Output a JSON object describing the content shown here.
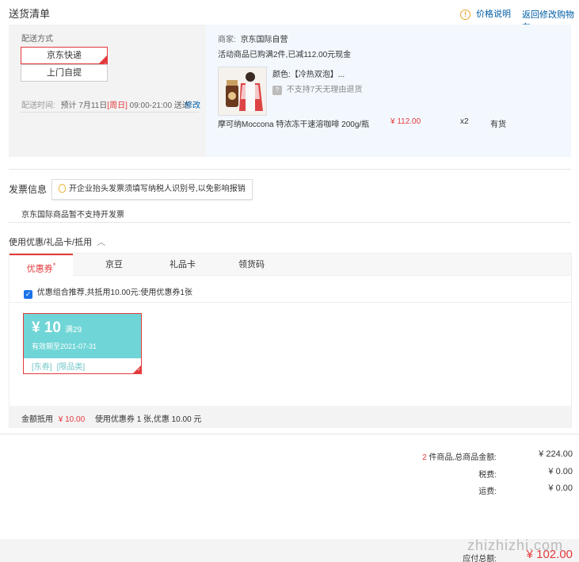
{
  "header": {
    "title": "送货清单",
    "price_info": "价格说明",
    "back_link": "返回修改购物车"
  },
  "shipping": {
    "method_label": "配送方式",
    "options": [
      "京东快递",
      "上门自提"
    ],
    "time_label": "配送时间:",
    "time_prefix": "预计 7月11日",
    "time_day": "[周日]",
    "time_range": "09:00-21:00 送达",
    "modify": "修改"
  },
  "seller": {
    "label": "商家:",
    "name": "京东国际自营",
    "promo": "活动商品已购满2件,已减112.00元现金",
    "color": "颜色:【冷热双泡】...",
    "return_policy": "不支持7天无理由退货",
    "product_name": "摩可纳Moccona 特浓冻干速溶咖啡 200g/瓶",
    "price": "¥ 112.00",
    "qty": "x2",
    "stock": "有货"
  },
  "invoice": {
    "title": "发票信息",
    "tip": "开企业抬头发票须填写纳税人识别号,以免影响报销",
    "note": "京东国际商品暂不支持开发票"
  },
  "discount": {
    "title": "使用优惠/礼品卡/抵用",
    "tabs": [
      "优惠券",
      "京豆",
      "礼品卡",
      "领货码"
    ],
    "tab_mark": "*",
    "recommend": "优惠组合推荐,共抵用10.00元:使用优惠券1张",
    "coupon": {
      "amount": "¥ 10",
      "condition": "满29",
      "validity": "有效期至2021-07-31",
      "tags": [
        "[东券]",
        "[限品类]"
      ]
    },
    "total_label": "金额抵用",
    "total_value": "¥ 10.00",
    "total_desc": "使用优惠券 1 张,优惠 10.00 元"
  },
  "summary": {
    "count": "2",
    "count_suffix": "件商品,总商品金额:",
    "goods_total": "¥ 224.00",
    "tax_label": "税费:",
    "tax": "¥ 0.00",
    "freight_label": "运费:",
    "freight": "¥ 0.00",
    "due_label": "应付总额:",
    "due": "¥ 102.00"
  },
  "watermark": "zhizhizhi.com"
}
